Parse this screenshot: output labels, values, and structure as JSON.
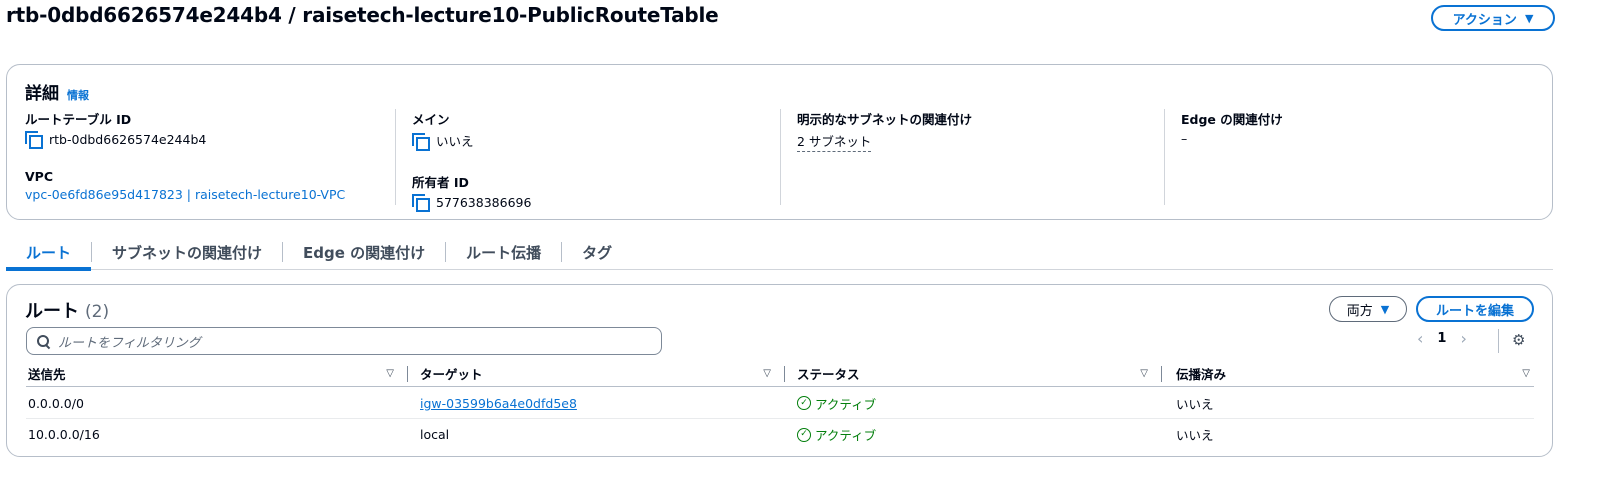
{
  "header": {
    "title": "rtb-0dbd6626574e244b4 / raisetech-lecture10-PublicRouteTable",
    "actions_label": "アクション"
  },
  "details": {
    "heading": "詳細",
    "info_link": "情報",
    "route_table_id_label": "ルートテーブル ID",
    "route_table_id": "rtb-0dbd6626574e244b4",
    "vpc_label": "VPC",
    "vpc_value": "vpc-0e6fd86e95d417823 | raisetech-lecture10-VPC",
    "main_label": "メイン",
    "main_value": "いいえ",
    "owner_label": "所有者 ID",
    "owner_value": "577638386696",
    "explicit_subnet_label": "明示的なサブネットの関連付け",
    "explicit_subnet_value": "2 サブネット",
    "edge_label": "Edge の関連付け",
    "edge_value": "–"
  },
  "tabs": [
    {
      "label": "ルート",
      "active": true
    },
    {
      "label": "サブネットの関連付け",
      "active": false
    },
    {
      "label": "Edge の関連付け",
      "active": false
    },
    {
      "label": "ルート伝播",
      "active": false
    },
    {
      "label": "タグ",
      "active": false
    }
  ],
  "routes": {
    "title": "ルート",
    "count": "(2)",
    "both_label": "両方",
    "edit_label": "ルートを編集",
    "filter_placeholder": "ルートをフィルタリング",
    "page": "1",
    "columns": [
      "送信先",
      "ターゲット",
      "ステータス",
      "伝播済み"
    ],
    "rows": [
      {
        "destination": "0.0.0.0/0",
        "target": "igw-03599b6a4e0dfd5e8",
        "target_is_link": true,
        "status": "アクティブ",
        "propagated": "いいえ"
      },
      {
        "destination": "10.0.0.0/16",
        "target": "local",
        "target_is_link": false,
        "status": "アクティブ",
        "propagated": "いいえ"
      }
    ]
  },
  "colors": {
    "accent": "#0972d3",
    "success": "#037f0c",
    "text": "#000716"
  }
}
